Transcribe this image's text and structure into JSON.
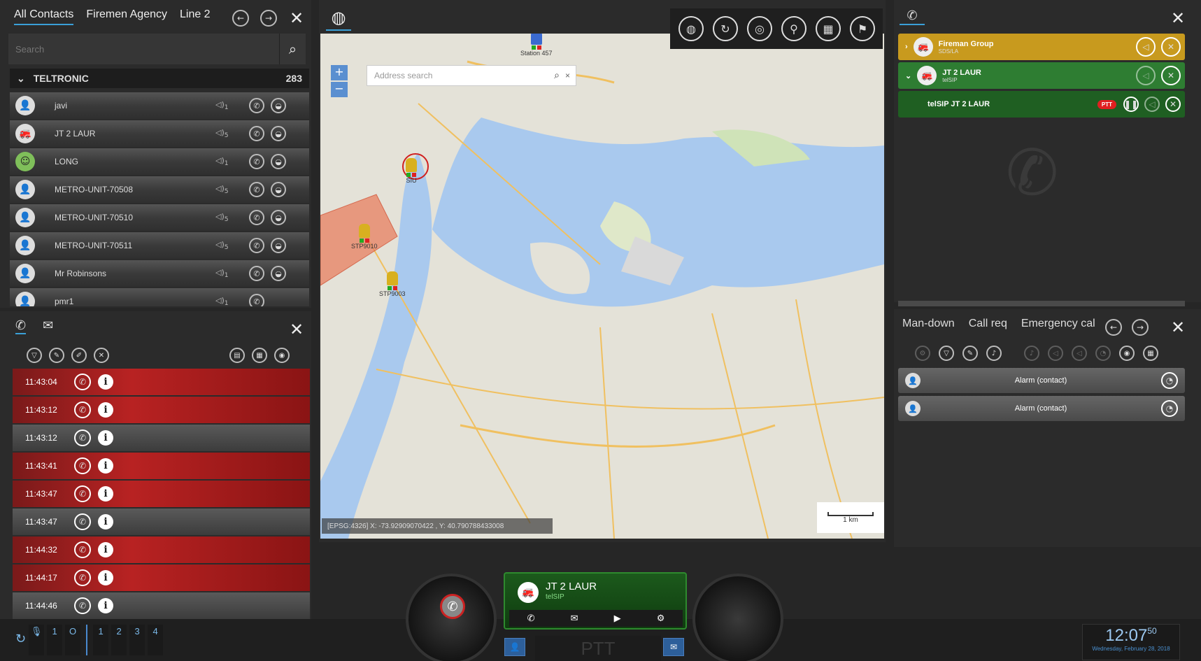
{
  "contacts": {
    "tabs": [
      "All Contacts",
      "Firemen Agency",
      "Line 2"
    ],
    "search_placeholder": "Search",
    "group": {
      "name": "TELTRONIC",
      "count": "283"
    },
    "items": [
      {
        "name": "javi",
        "vol": "1"
      },
      {
        "name": "JT 2 LAUR",
        "vol": "5"
      },
      {
        "name": "LONG",
        "vol": "1"
      },
      {
        "name": "METRO-UNIT-70508",
        "vol": "5"
      },
      {
        "name": "METRO-UNIT-70510",
        "vol": "5"
      },
      {
        "name": "METRO-UNIT-70511",
        "vol": "5"
      },
      {
        "name": "Mr Robinsons",
        "vol": "1"
      },
      {
        "name": "pmr1",
        "vol": "1"
      }
    ]
  },
  "calllog": {
    "entries": [
      {
        "time": "11:43:04",
        "status": "missed"
      },
      {
        "time": "11:43:12",
        "status": "missed"
      },
      {
        "time": "11:43:12",
        "status": "answered"
      },
      {
        "time": "11:43:41",
        "status": "missed"
      },
      {
        "time": "11:43:47",
        "status": "missed"
      },
      {
        "time": "11:43:47",
        "status": "answered"
      },
      {
        "time": "11:44:32",
        "status": "missed"
      },
      {
        "time": "11:44:17",
        "status": "missed"
      },
      {
        "time": "11:44:46",
        "status": "answered"
      }
    ]
  },
  "map": {
    "address_placeholder": "Address search",
    "coords": "[EPSG:4326] X: -73.92909070422 , Y: 40.790788433008",
    "scale": "1 km",
    "markers": [
      "Station 457",
      "SIU",
      "STP9010",
      "STP9003"
    ]
  },
  "calls": {
    "rows": [
      {
        "name": "Fireman Group",
        "sub": "SDS/LA",
        "color": "#c89a1e"
      },
      {
        "name": "JT 2 LAUR",
        "sub": "telSIP",
        "color": "#2e7d32"
      },
      {
        "name": "telSIP JT 2 LAUR",
        "sub": "",
        "badge": "PTT",
        "color": "#1f5f22"
      }
    ]
  },
  "alarms": {
    "tabs": [
      "Man-down",
      "Call req",
      "Emergency cal"
    ],
    "rows": [
      {
        "label": "Alarm (contact)"
      },
      {
        "label": "Alarm (contact)"
      }
    ]
  },
  "console": {
    "name": "JT 2 LAUR",
    "sub": "telSIP",
    "ptt": "PTT"
  },
  "bottom": {
    "lines": [
      "1",
      "O",
      "1",
      "2",
      "3",
      "4"
    ],
    "time": "12:07",
    "seconds": "50",
    "date": "Wednesday, February 28, 2018"
  }
}
